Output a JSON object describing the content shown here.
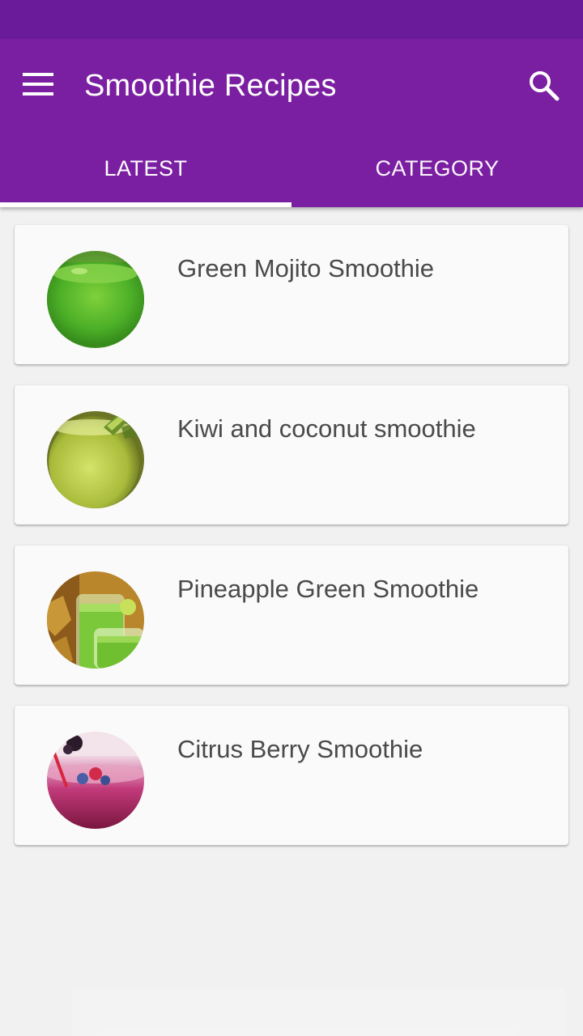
{
  "app": {
    "title": "Smoothie Recipes"
  },
  "icons": {
    "menu": "menu-icon",
    "search": "search-icon"
  },
  "colors": {
    "status_bar": "#6a1b9a",
    "primary": "#7b1fa2",
    "tab_indicator": "#ffffff",
    "background": "#f1f1f1",
    "card": "#fafafa",
    "card_text": "#4a4a4a"
  },
  "tabs": [
    {
      "label": "LATEST",
      "selected": true
    },
    {
      "label": "CATEGORY",
      "selected": false
    }
  ],
  "recipes": [
    {
      "title": "Green Mojito Smoothie",
      "thumbnail": "green-smoothie-glass"
    },
    {
      "title": "Kiwi and coconut smoothie",
      "thumbnail": "kiwi-smoothie-glass"
    },
    {
      "title": "Pineapple Green Smoothie",
      "thumbnail": "pineapple-smoothie-glasses"
    },
    {
      "title": "Citrus Berry Smoothie",
      "thumbnail": "berry-smoothie-glass"
    }
  ]
}
